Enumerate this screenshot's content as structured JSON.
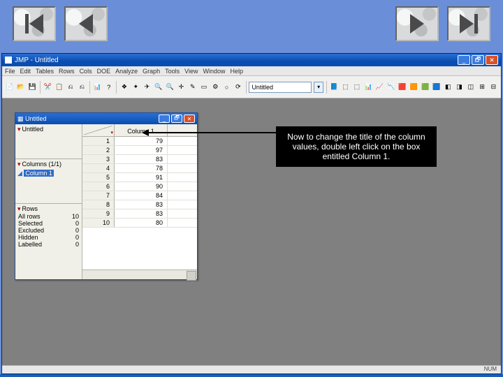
{
  "nav": {
    "first_name": "first-slide",
    "prev_name": "previous-slide",
    "next_name": "next-slide",
    "last_name": "last-slide"
  },
  "app": {
    "icon": "▦",
    "title": "JMP - Untitled",
    "minimize": "_",
    "restore": "🗗",
    "close": "✕"
  },
  "menu": {
    "items": [
      "File",
      "Edit",
      "Tables",
      "Rows",
      "Cols",
      "DOE",
      "Analyze",
      "Graph",
      "Tools",
      "View",
      "Window",
      "Help"
    ]
  },
  "toolbar": {
    "icons": [
      "📄",
      "📂",
      "💾",
      "✂️",
      "📋",
      "⎌",
      "⎌",
      "📊",
      "?",
      "❖",
      "✦",
      "✈",
      "🔍",
      "🔍",
      "✛",
      "✎",
      "▭",
      "⚙",
      "○",
      "⟳"
    ],
    "field_value": "Untitled",
    "row2_icons": [
      "📘",
      "⬚",
      "⬚",
      "📊",
      "📈",
      "📉",
      "🟥",
      "🟧",
      "🟩",
      "🟦",
      "◧",
      "◨",
      "◫",
      "⊞",
      "⊟"
    ]
  },
  "datawin": {
    "title": "Untitled",
    "minimize": "_",
    "restore": "🗗",
    "close": "✕",
    "panel_name": "Untitled",
    "columns_header": "Columns (1/1)",
    "column_item": "Column 1",
    "rows_header": "Rows",
    "row_stats": [
      {
        "label": "All rows",
        "value": "10"
      },
      {
        "label": "Selected",
        "value": "0"
      },
      {
        "label": "Excluded",
        "value": "0"
      },
      {
        "label": "Hidden",
        "value": "0"
      },
      {
        "label": "Labelled",
        "value": "0"
      }
    ],
    "col_header": "Column 1",
    "rows": [
      {
        "n": "1",
        "v": "79"
      },
      {
        "n": "2",
        "v": "97"
      },
      {
        "n": "3",
        "v": "83"
      },
      {
        "n": "4",
        "v": "78"
      },
      {
        "n": "5",
        "v": "91"
      },
      {
        "n": "6",
        "v": "90"
      },
      {
        "n": "7",
        "v": "84"
      },
      {
        "n": "8",
        "v": "83"
      },
      {
        "n": "9",
        "v": "83"
      },
      {
        "n": "10",
        "v": "80"
      }
    ]
  },
  "callout": {
    "text": "Now to change the title of the column values, double left click on the box entitled Column 1."
  },
  "status": {
    "text": "NUM"
  }
}
